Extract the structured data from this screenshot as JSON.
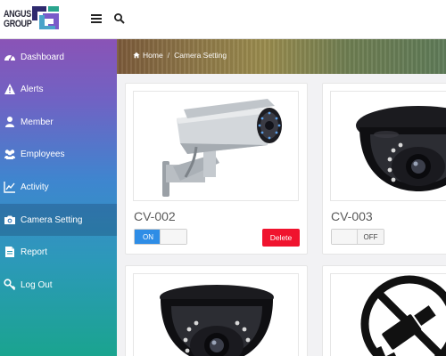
{
  "brand": {
    "name_line1": "ANGUS",
    "name_line2": "GROUP",
    "accent": "#5b4ea8"
  },
  "header": {
    "menu_icon": "bars-icon",
    "search_icon": "search-icon"
  },
  "sidebar": {
    "items": [
      {
        "label": "Dashboard",
        "icon": "dashboard-icon",
        "active": false
      },
      {
        "label": "Alerts",
        "icon": "warning-icon",
        "active": false
      },
      {
        "label": "Member",
        "icon": "user-icon",
        "active": false
      },
      {
        "label": "Employees",
        "icon": "users-icon",
        "active": false
      },
      {
        "label": "Activity",
        "icon": "line-chart-icon",
        "active": false
      },
      {
        "label": "Camera Setting",
        "icon": "camera-icon",
        "active": true
      },
      {
        "label": "Report",
        "icon": "file-icon",
        "active": false
      },
      {
        "label": "Log Out",
        "icon": "key-icon",
        "active": false
      }
    ]
  },
  "breadcrumb": {
    "home": "Home",
    "separator": "/",
    "current": "Camera Setting"
  },
  "cameras": [
    {
      "name": "CV-002",
      "status": "ON",
      "toggle_on_label": "ON",
      "delete_label": "Delete",
      "image": "bullet-camera"
    },
    {
      "name": "CV-003",
      "status": "OFF",
      "toggle_off_label": "OFF",
      "image": "dome-camera"
    },
    {
      "name": "",
      "image": "dome-camera"
    },
    {
      "name": "",
      "image": "no-camera"
    }
  ],
  "colors": {
    "toggle_on": "#2e8de6",
    "delete": "#f0132e"
  }
}
